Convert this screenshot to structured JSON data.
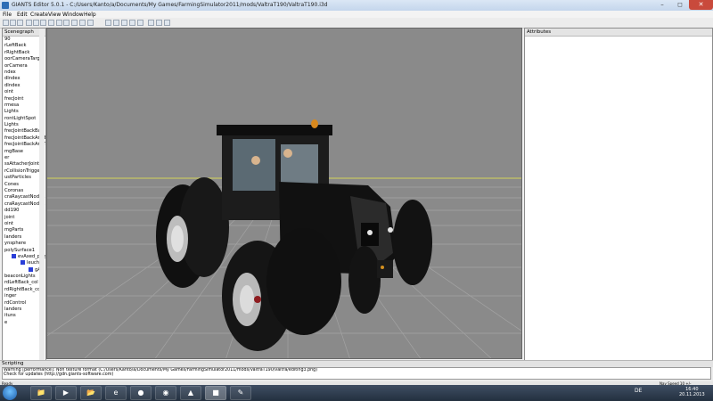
{
  "window": {
    "title": "GIANTS Editor 5.0.1 - C:/Users/Kanto/a/Documents/My Games/FarmingSimulator2011/mods/ValtraT190/ValtraT190.i3d"
  },
  "menu": [
    "File",
    "Edit",
    "Create",
    "View",
    "Window",
    "Help"
  ],
  "panels": {
    "scenegraph": "Scenegraph",
    "attributes": "Attributes",
    "scripting": "Scripting"
  },
  "scenegraph_items": [
    "90",
    "rLeftBack",
    "rRightBack",
    "oorCameraTarget",
    "orCamera",
    "ndex",
    "dIndex",
    "dIndex",
    "oint",
    "frecJoint",
    "rmesa",
    "Lights",
    "rontLightSpot",
    "Lights",
    "frecJointBackBat",
    "frecJointBackArmBo",
    "frecJointBackArmTo",
    "mgBase",
    "er",
    "ssAttacherJoint",
    "rCollisionTrigger",
    "ustParticles",
    "Cones",
    "Coronas",
    "craRaycastNode1",
    "craRaycastNode2",
    "dd190",
    "joint",
    "oint",
    "mgParts",
    "landers",
    "ynsphere",
    "polySurface1",
    "evAxed_polyS",
    "leucht",
    "gA",
    "beaconLights",
    "rdLeftBack_col",
    "rdRightBack_col",
    "inger",
    "rdControl",
    "landers",
    "ituns",
    "e"
  ],
  "scripting_log": [
    "Warning [performance]: Non texture format (C:/Users/Kanto/a/Documents/My Games/FarmingSimulator2011/mods/ValtraT190/valtra/editing3.png)",
    "Check for updates (http://gdn.giants-software.com)"
  ],
  "status": {
    "left": "Ready",
    "right": "Nav Speed 10 +/-"
  },
  "clock": {
    "time": "16:40",
    "date": "20.11.2013"
  },
  "tray": "DE",
  "colors": {
    "viewport_bg": "#8a8a8a",
    "grid_line": "#9d9d9d",
    "axis_yellow": "#d4d45a",
    "tractor_body": "#141414",
    "taskbar": "#2f3d52"
  }
}
